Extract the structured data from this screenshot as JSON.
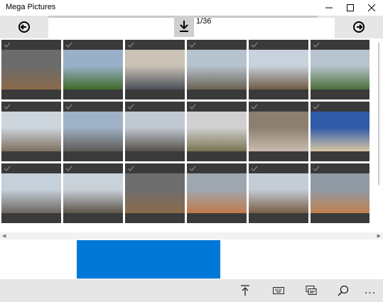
{
  "app": {
    "title": "Mega Pictures"
  },
  "toolbar": {
    "counter": "1/36",
    "progress_fraction": 0.94
  },
  "gallery": {
    "thumbnails": [
      {
        "name": "manhole-cover",
        "colors": [
          "#6b6b6b",
          "#8a6a4a"
        ]
      },
      {
        "name": "green-field",
        "colors": [
          "#9ab0c8",
          "#3f6b2a"
        ]
      },
      {
        "name": "tank-model-gray",
        "colors": [
          "#c9c2b5",
          "#4a5058"
        ]
      },
      {
        "name": "canal-street",
        "colors": [
          "#b7c2cf",
          "#6a6152"
        ]
      },
      {
        "name": "bare-trees",
        "colors": [
          "#c8d2dc",
          "#6e5a44"
        ]
      },
      {
        "name": "river-bridge",
        "colors": [
          "#b8c4cf",
          "#4b6d37"
        ]
      },
      {
        "name": "canal-steps",
        "colors": [
          "#cdd5dd",
          "#7d6f5e"
        ]
      },
      {
        "name": "street-sign",
        "colors": [
          "#9fb2c6",
          "#5d5a55"
        ]
      },
      {
        "name": "street-buildings",
        "colors": [
          "#c1c9d2",
          "#55504a"
        ]
      },
      {
        "name": "tank-model-olive",
        "colors": [
          "#d0d0d0",
          "#7a7452"
        ]
      },
      {
        "name": "statue",
        "colors": [
          "#8b7f70",
          "#c9bcae"
        ]
      },
      {
        "name": "tank-model-tan",
        "colors": [
          "#2e5aa8",
          "#d9c8a3"
        ]
      },
      {
        "name": "canal-walls",
        "colors": [
          "#c6d0da",
          "#6b6660"
        ]
      },
      {
        "name": "canal-trees",
        "colors": [
          "#c9d1d9",
          "#5c5548"
        ]
      },
      {
        "name": "manhole-cover-2",
        "colors": [
          "#6e6e6e",
          "#8a6a4a"
        ]
      },
      {
        "name": "tile-floor",
        "colors": [
          "#9ea7b0",
          "#c27a4a"
        ]
      },
      {
        "name": "fence-path",
        "colors": [
          "#c4cdd6",
          "#7a5e46"
        ]
      },
      {
        "name": "tile-floor-2",
        "colors": [
          "#8f9aa5",
          "#c2804f"
        ]
      }
    ]
  },
  "appbar": {
    "more_label": "..."
  }
}
